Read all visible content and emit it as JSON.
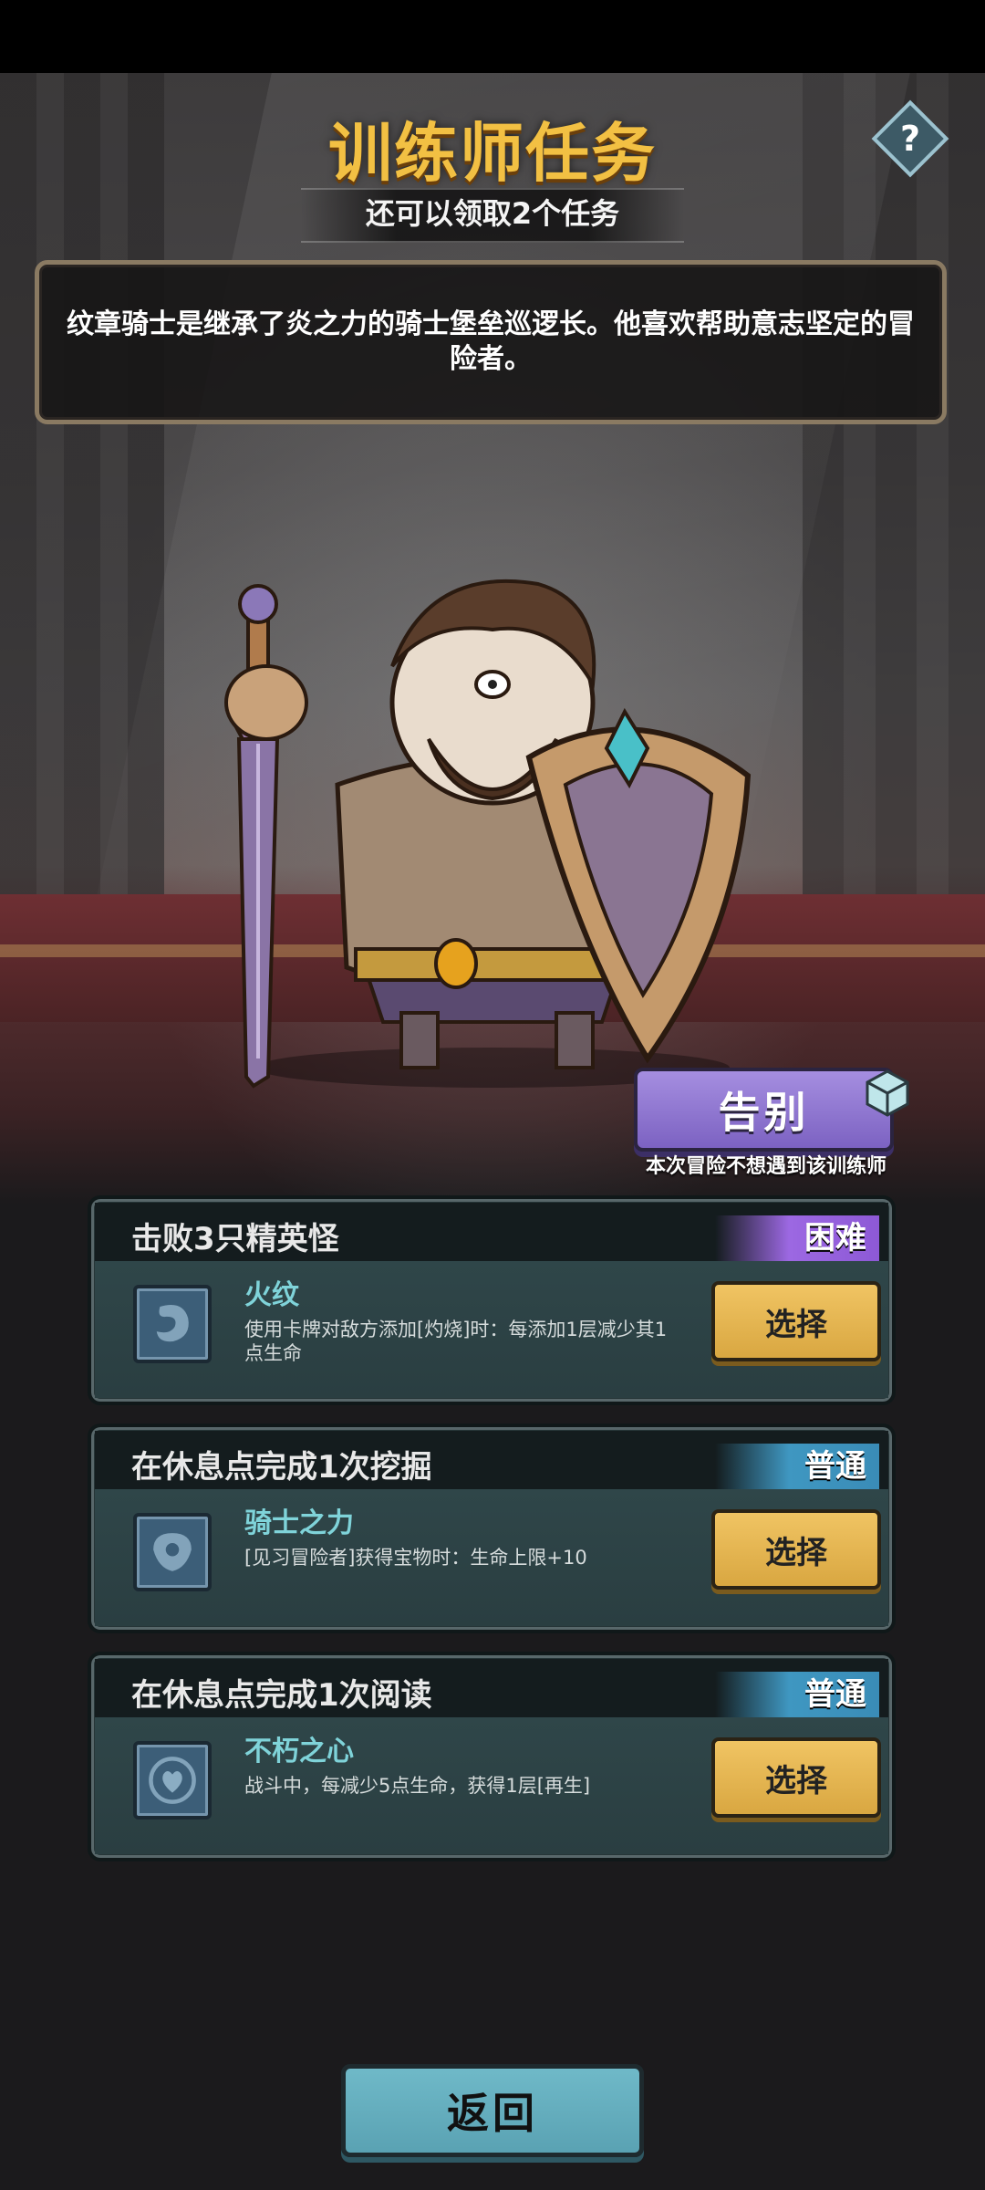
{
  "header": {
    "title": "训练师任务",
    "subtitle": "还可以领取2个任务",
    "help": "?"
  },
  "description": "纹章骑士是继承了炎之力的骑士堡垒巡逻长。他喜欢帮助意志坚定的冒险者。",
  "farewell": {
    "label": "告别",
    "note": "本次冒险不想遇到该训练师"
  },
  "tasks": [
    {
      "title": "击败3只精英怪",
      "difficulty": "困难",
      "relic_name": "火纹",
      "relic_desc": "使用卡牌对敌方添加[灼烧]时：每添加1层减少其1点生命",
      "select": "选择",
      "icon": "flame-emblem-icon"
    },
    {
      "title": "在休息点完成1次挖掘",
      "difficulty": "普通",
      "relic_name": "骑士之力",
      "relic_desc": "[见习冒险者]获得宝物时：生命上限+10",
      "select": "选择",
      "icon": "knight-emblem-icon"
    },
    {
      "title": "在休息点完成1次阅读",
      "difficulty": "普通",
      "relic_name": "不朽之心",
      "relic_desc": "战斗中，每减少5点生命，获得1层[再生]",
      "select": "选择",
      "icon": "heart-emblem-icon"
    }
  ],
  "back": "返回",
  "colors": {
    "title": "#f2c043",
    "hard": "#9c68e2",
    "normal": "#3f97c1",
    "select_button": "#f0c463",
    "back_button": "#6fb9c8",
    "farewell_button": "#8f76d4"
  }
}
